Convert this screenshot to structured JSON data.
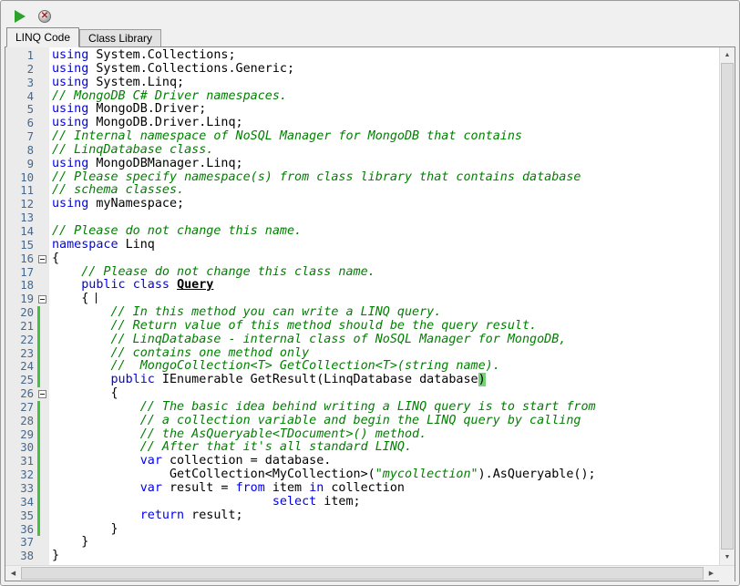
{
  "toolbar": {
    "buttons": [
      {
        "name": "run",
        "icon": "play-icon"
      },
      {
        "name": "stop",
        "icon": "stop-icon"
      }
    ]
  },
  "tabs": [
    {
      "label": "LINQ Code",
      "active": true
    },
    {
      "label": "Class Library",
      "active": false
    }
  ],
  "editor": {
    "colors": {
      "keyword": "#0000f0",
      "comment": "#008000",
      "string": "#008000",
      "line_number": "#44688e",
      "change_bar": "#42c33e",
      "match_highlight": "#76d276"
    },
    "lines": [
      {
        "n": 1,
        "segs": [
          [
            "k",
            "using"
          ],
          [
            "p",
            " System.Collections;"
          ]
        ]
      },
      {
        "n": 2,
        "segs": [
          [
            "k",
            "using"
          ],
          [
            "p",
            " System.Collections.Generic;"
          ]
        ]
      },
      {
        "n": 3,
        "segs": [
          [
            "k",
            "using"
          ],
          [
            "p",
            " System.Linq;"
          ]
        ]
      },
      {
        "n": 4,
        "segs": [
          [
            "c",
            "// MongoDB C# Driver namespaces."
          ]
        ]
      },
      {
        "n": 5,
        "segs": [
          [
            "k",
            "using"
          ],
          [
            "p",
            " MongoDB.Driver;"
          ]
        ]
      },
      {
        "n": 6,
        "segs": [
          [
            "k",
            "using"
          ],
          [
            "p",
            " MongoDB.Driver.Linq;"
          ]
        ]
      },
      {
        "n": 7,
        "segs": [
          [
            "c",
            "// Internal namespace of NoSQL Manager for MongoDB that contains"
          ]
        ]
      },
      {
        "n": 8,
        "segs": [
          [
            "c",
            "// LinqDatabase class."
          ]
        ]
      },
      {
        "n": 9,
        "segs": [
          [
            "k",
            "using"
          ],
          [
            "p",
            " MongoDBManager.Linq;"
          ]
        ]
      },
      {
        "n": 10,
        "segs": [
          [
            "c",
            "// Please specify namespace(s) from class library that contains database"
          ]
        ]
      },
      {
        "n": 11,
        "segs": [
          [
            "c",
            "// schema classes."
          ]
        ]
      },
      {
        "n": 12,
        "segs": [
          [
            "k",
            "using"
          ],
          [
            "p",
            " myNamespace;"
          ]
        ]
      },
      {
        "n": 13,
        "segs": []
      },
      {
        "n": 14,
        "segs": [
          [
            "c",
            "// Please do not change this name."
          ]
        ]
      },
      {
        "n": 15,
        "segs": [
          [
            "k",
            "namespace"
          ],
          [
            "p",
            " Linq"
          ]
        ]
      },
      {
        "n": 16,
        "fold": true,
        "segs": [
          [
            "p",
            "{"
          ]
        ]
      },
      {
        "n": 17,
        "segs": [
          [
            "c",
            "    // Please do not change this class name."
          ]
        ]
      },
      {
        "n": 18,
        "segs": [
          [
            "p",
            "    "
          ],
          [
            "k",
            "public"
          ],
          [
            "p",
            " "
          ],
          [
            "k",
            "class"
          ],
          [
            "p",
            " "
          ],
          [
            "u",
            "Query"
          ]
        ]
      },
      {
        "n": 19,
        "fold": true,
        "segs": [
          [
            "p",
            "    { "
          ],
          [
            "cur",
            ""
          ]
        ]
      },
      {
        "n": 20,
        "changed": true,
        "segs": [
          [
            "c",
            "        // In this method you can write a LINQ query."
          ]
        ]
      },
      {
        "n": 21,
        "changed": true,
        "segs": [
          [
            "c",
            "        // Return value of this method should be the query result."
          ]
        ]
      },
      {
        "n": 22,
        "changed": true,
        "segs": [
          [
            "c",
            "        // LinqDatabase - internal class of NoSQL Manager for MongoDB,"
          ]
        ]
      },
      {
        "n": 23,
        "changed": true,
        "segs": [
          [
            "c",
            "        // contains one method only"
          ]
        ]
      },
      {
        "n": 24,
        "changed": true,
        "segs": [
          [
            "c",
            "        //  MongoCollection<T> GetCollection<T>(string name)."
          ]
        ]
      },
      {
        "n": 25,
        "changed": true,
        "segs": [
          [
            "p",
            "        "
          ],
          [
            "k",
            "public"
          ],
          [
            "p",
            " IEnumerable GetResult(LinqDatabase database"
          ],
          [
            "h",
            ")"
          ]
        ]
      },
      {
        "n": 26,
        "fold": true,
        "segs": [
          [
            "p",
            "        {"
          ]
        ]
      },
      {
        "n": 27,
        "changed": true,
        "segs": [
          [
            "c",
            "            // The basic idea behind writing a LINQ query is to start from"
          ]
        ]
      },
      {
        "n": 28,
        "changed": true,
        "segs": [
          [
            "c",
            "            // a collection variable and begin the LINQ query by calling"
          ]
        ]
      },
      {
        "n": 29,
        "changed": true,
        "segs": [
          [
            "c",
            "            // the AsQueryable<TDocument>() method."
          ]
        ]
      },
      {
        "n": 30,
        "changed": true,
        "segs": [
          [
            "c",
            "            // After that it's all standard LINQ."
          ]
        ]
      },
      {
        "n": 31,
        "changed": true,
        "segs": [
          [
            "p",
            "            "
          ],
          [
            "k",
            "var"
          ],
          [
            "p",
            " collection = database."
          ]
        ]
      },
      {
        "n": 32,
        "changed": true,
        "segs": [
          [
            "p",
            "                GetCollection<MyCollection>("
          ],
          [
            "s",
            "\"mycollection\""
          ],
          [
            "p",
            ").AsQueryable();"
          ]
        ]
      },
      {
        "n": 33,
        "changed": true,
        "segs": [
          [
            "p",
            "            "
          ],
          [
            "k",
            "var"
          ],
          [
            "p",
            " result = "
          ],
          [
            "k",
            "from"
          ],
          [
            "p",
            " item "
          ],
          [
            "k",
            "in"
          ],
          [
            "p",
            " collection"
          ]
        ]
      },
      {
        "n": 34,
        "changed": true,
        "segs": [
          [
            "p",
            "                              "
          ],
          [
            "k",
            "select"
          ],
          [
            "p",
            " item;"
          ]
        ]
      },
      {
        "n": 35,
        "changed": true,
        "segs": [
          [
            "p",
            "            "
          ],
          [
            "k",
            "return"
          ],
          [
            "p",
            " result;"
          ]
        ]
      },
      {
        "n": 36,
        "changed": true,
        "segs": [
          [
            "p",
            "        }"
          ]
        ]
      },
      {
        "n": 37,
        "segs": [
          [
            "p",
            "    }"
          ]
        ]
      },
      {
        "n": 38,
        "segs": [
          [
            "p",
            "}"
          ]
        ]
      }
    ]
  },
  "scrollbars": {
    "up_arrow": "▲",
    "down_arrow": "▼",
    "left_arrow": "◀",
    "right_arrow": "▶"
  }
}
